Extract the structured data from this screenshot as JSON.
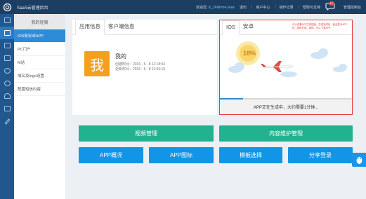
{
  "header": {
    "brand": "SaaS云管理后台",
    "welcome": "欢迎您,",
    "username": "lc_24ikhm4.saas",
    "links": [
      "退出",
      "用户中心",
      "操作记录",
      "帮助与支持"
    ],
    "badge_count": "17",
    "console": "管理控制台"
  },
  "iconbar": {
    "icons": [
      "monitor-icon",
      "app-icon",
      "chart-icon",
      "device-icon",
      "chat-icon",
      "settings-icon",
      "user-icon",
      "lock-icon",
      "edit-icon"
    ],
    "active_index": 1
  },
  "sidebar": {
    "title": "我的轻骑",
    "items": [
      {
        "label": "IOS和安卓APP",
        "active": true
      },
      {
        "label": "PC门户",
        "active": false
      },
      {
        "label": "M站",
        "active": false
      },
      {
        "label": "域名及logo设置",
        "active": false
      },
      {
        "label": "配置短信内容",
        "active": false
      }
    ]
  },
  "app_panel": {
    "tabs": [
      "应用信息",
      "客户端信息"
    ],
    "active_tab": 0,
    "icon_char": "我",
    "name": "我的",
    "created": "创建时间：2016 - 6 - 8 11:18:53",
    "updated": "更新时间：2016 - 6 - 8 11:56:19"
  },
  "preview_panel": {
    "tabs": [
      "IOS",
      "安卓"
    ],
    "active_tab": 0,
    "note": "可以查看APP生成进度，生成完成后，就会显示APP的二维码扫描二维码，可以下载APP。",
    "progress_text": "18%",
    "progress": 0.18,
    "status": "APP正在生成中，大约需要1分钟..."
  },
  "actions": {
    "row1": [
      "视频管理",
      "内容维护管理"
    ],
    "row2": [
      "APP概况",
      "APP图标",
      "模板选择",
      "分享登录"
    ]
  },
  "colors": {
    "topbar": "#1d3e63",
    "iconbar": "#22578e",
    "sidebar_active": "#2e8bd8",
    "green_button": "#22b28f",
    "blue_button": "#1295e6",
    "app_icon": "#f3a01d",
    "highlight_border": "#e63b3b"
  }
}
